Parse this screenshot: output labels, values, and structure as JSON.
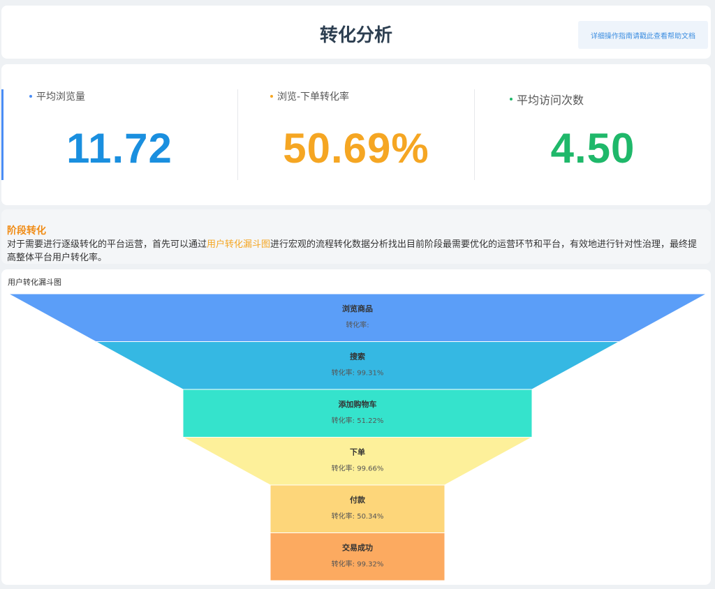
{
  "header": {
    "title": "转化分析",
    "help_link": "详细操作指南请戳此查看帮助文档"
  },
  "kpis": [
    {
      "label": "平均浏览量",
      "value": "11.72",
      "color": "#1a8fdf",
      "dot_color": "#4a8df5"
    },
    {
      "label": "浏览-下单转化率",
      "value": "50.69%",
      "color": "#f5a623",
      "dot_color": "#f5a623"
    },
    {
      "label": "平均访问次数",
      "value": "4.50",
      "color": "#1fb86a",
      "dot_color": "#1fb86a"
    }
  ],
  "section": {
    "title": "阶段转化",
    "desc_part1": "对于需要进行逐级转化的平台运营，首先可以通过",
    "desc_link": "用户转化漏斗图",
    "desc_part2": "进行宏观的流程转化数据分析找出目前阶段最需要优化的运营环节和平台，有效地进行针对性治理，最终提高整体平台用户转化率。"
  },
  "funnel": {
    "title": "用户转化漏斗图",
    "rate_prefix": "转化率:",
    "stages": [
      {
        "name": "浏览商品",
        "rate": "",
        "level": 1.0,
        "color": "#5b9ef8"
      },
      {
        "name": "搜索",
        "rate": "99.31%",
        "level": 0.75,
        "color": "#35b8e3"
      },
      {
        "name": "添加购物车",
        "rate": "51.22%",
        "level": 0.5,
        "color": "#35e3cc"
      },
      {
        "name": "下单",
        "rate": "99.66%",
        "level": 0.5,
        "color": "#fdf09a"
      },
      {
        "name": "付款",
        "rate": "50.34%",
        "level": 0.25,
        "color": "#fdd67a"
      },
      {
        "name": "交易成功",
        "rate": "99.32%",
        "level": 0.25,
        "color": "#fcaa60"
      }
    ]
  }
}
